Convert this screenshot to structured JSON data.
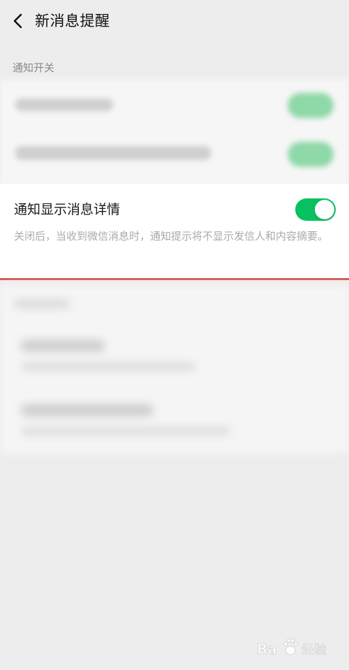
{
  "header": {
    "back_icon": "chevron-left-icon",
    "title": "新消息提醒"
  },
  "sections": [
    {
      "header": "通知开关"
    }
  ],
  "setting": {
    "title": "通知显示消息详情",
    "description": "关闭后，当收到微信消息时，通知提示将不显示发信人和内容摘要。",
    "toggle_on": true,
    "toggle_color": "#07c160"
  },
  "watermark": {
    "logo_text": "Baidu经验",
    "logo_icon": "paw-icon"
  }
}
